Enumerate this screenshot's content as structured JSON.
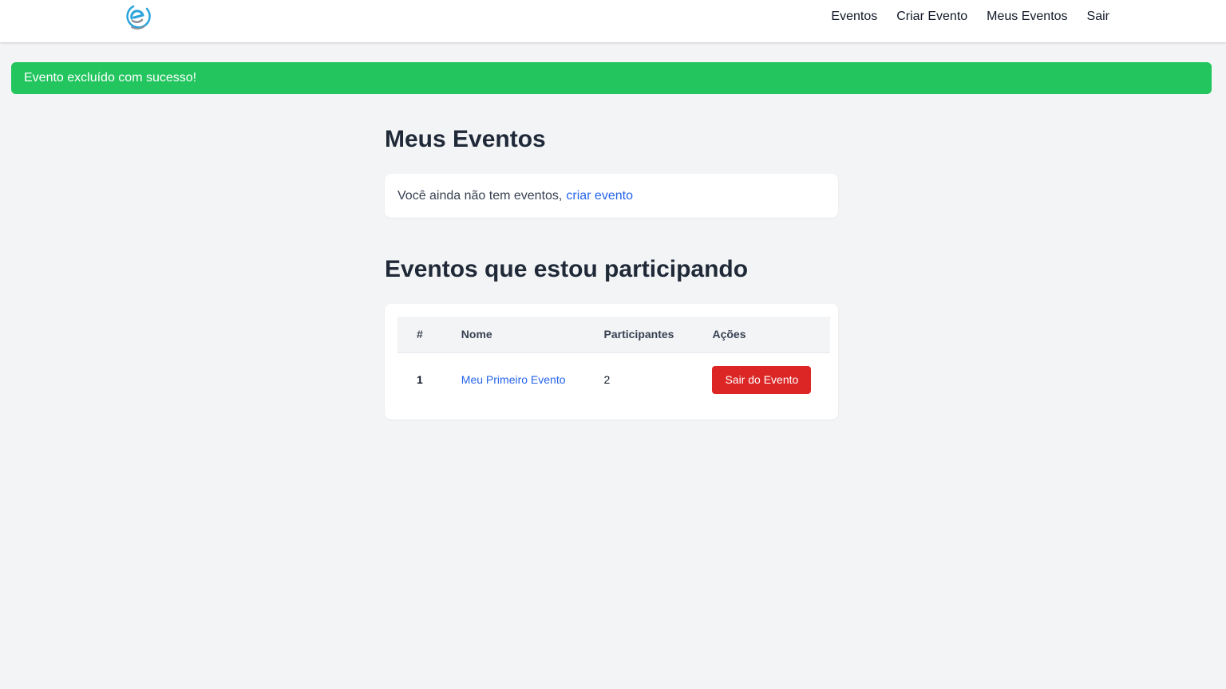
{
  "colors": {
    "alert_success": "#22c55e",
    "link": "#2563eb",
    "danger_button": "#dc2626",
    "page_background": "#f3f4f6"
  },
  "nav": {
    "logo_icon": "circular-swirl-logo-icon",
    "links": [
      "Eventos",
      "Criar Evento",
      "Meus Eventos",
      "Sair"
    ]
  },
  "alert": {
    "message": "Evento excluído com sucesso!"
  },
  "my_events": {
    "title": "Meus Eventos",
    "empty_text": "Você ainda não tem eventos,",
    "create_link": "criar evento"
  },
  "participating": {
    "title": "Eventos que estou participando",
    "columns": [
      "#",
      "Nome",
      "Participantes",
      "Ações"
    ],
    "rows": [
      {
        "index": "1",
        "name": "Meu Primeiro Evento",
        "participants": "2",
        "action": "Sair do Evento"
      }
    ]
  }
}
